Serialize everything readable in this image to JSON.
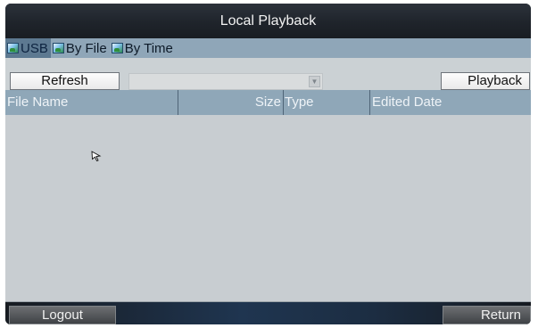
{
  "window": {
    "title": "Local Playback"
  },
  "tabs": [
    {
      "label": "USB",
      "icon": "usb-device-icon",
      "active": true
    },
    {
      "label": "By File",
      "icon": "by-file-icon",
      "active": false
    },
    {
      "label": "By Time",
      "icon": "by-time-icon",
      "active": false
    }
  ],
  "toolbar": {
    "refresh_label": "Refresh",
    "device_select_value": "",
    "playback_label": "Playback"
  },
  "table": {
    "columns": [
      "File Name",
      "Size",
      "Type",
      "Edited Date"
    ],
    "rows": []
  },
  "footer": {
    "logout_label": "Logout",
    "return_label": "Return"
  },
  "colors": {
    "header_accent": "#8fa7b8",
    "active_tab": "#5d7991",
    "body_bg": "#c8cdd1"
  }
}
